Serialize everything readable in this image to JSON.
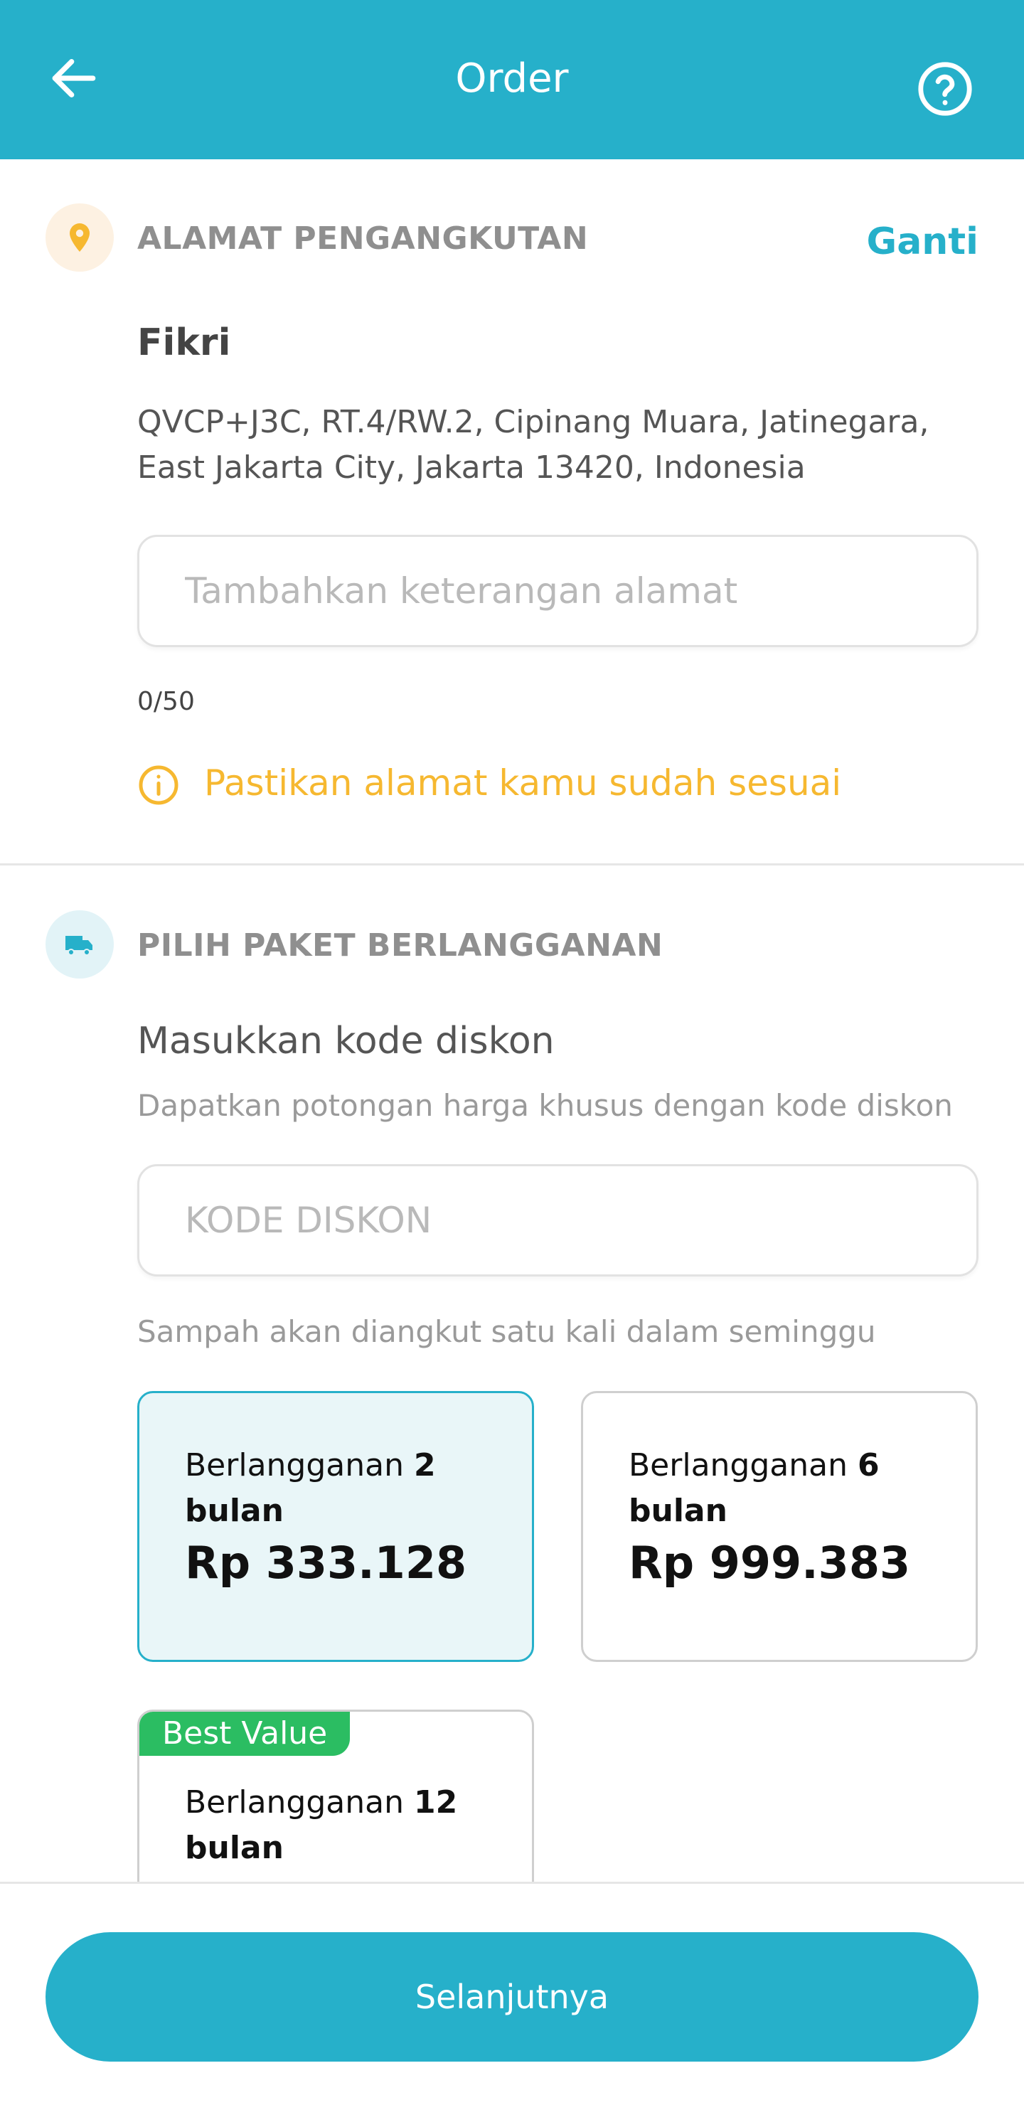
{
  "header": {
    "title": "Order",
    "back_icon": "arrow-left-icon",
    "help_icon": "question-circle-icon"
  },
  "pickup": {
    "section_title": "ALAMAT PENGANGKUTAN",
    "section_icon": "location-pin-icon",
    "change_label": "Ganti",
    "name": "Fikri",
    "address": "QVCP+J3C, RT.4/RW.2, Cipinang Muara, Jatinegara, East Jakarta City, Jakarta 13420, Indonesia",
    "note_placeholder": "Tambahkan keterangan alamat",
    "note_value": "",
    "counter": "0/50",
    "warning_icon": "info-circle-icon",
    "warning": "Pastikan alamat kamu sudah sesuai"
  },
  "subscription": {
    "section_title": "PILIH PAKET BERLANGGANAN",
    "section_icon": "truck-icon",
    "discount_title": "Masukkan kode diskon",
    "discount_subtitle": "Dapatkan potongan harga khusus dengan kode diskon",
    "discount_placeholder": "KODE DISKON",
    "discount_value": "",
    "frequency_note": "Sampah akan diangkut satu kali dalam seminggu",
    "plans": [
      {
        "label_prefix": "Berlangganan ",
        "months": "2",
        "label_suffix": "bulan",
        "price": "Rp 333.128",
        "selected": true
      },
      {
        "label_prefix": "Berlangganan ",
        "months": "6",
        "label_suffix": "bulan",
        "price": "Rp 999.383",
        "selected": false
      },
      {
        "label_prefix": "Berlangganan ",
        "months": "12",
        "label_suffix": "bulan",
        "badge": "Best Value",
        "selected": false
      }
    ]
  },
  "footer": {
    "next_label": "Selanjutnya"
  },
  "colors": {
    "primary": "#26b0ca",
    "warning": "#f6b830",
    "badge": "#2bbd62",
    "selected_bg": "#e9f6f8"
  }
}
